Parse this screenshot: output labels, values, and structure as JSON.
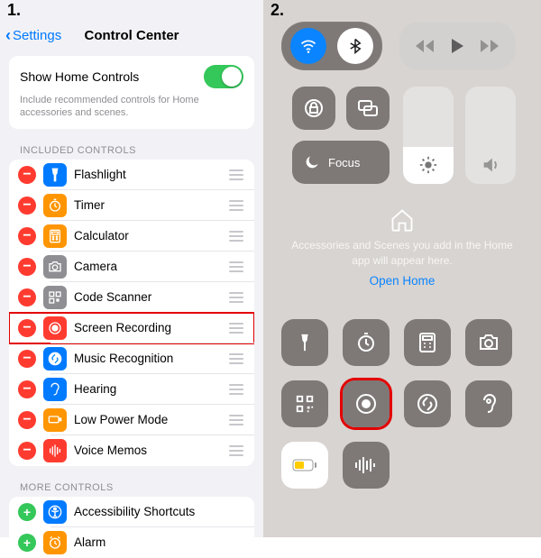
{
  "steps": {
    "one": "1.",
    "two": "2."
  },
  "left": {
    "back": "Settings",
    "title": "Control Center",
    "showHomeLabel": "Show Home Controls",
    "showHomeHint": "Include recommended controls for Home accessories and scenes.",
    "includedHeader": "INCLUDED CONTROLS",
    "moreHeader": "MORE CONTROLS",
    "included": [
      {
        "label": "Flashlight",
        "color": "blue",
        "icon": "flashlight"
      },
      {
        "label": "Timer",
        "color": "orange",
        "icon": "timer"
      },
      {
        "label": "Calculator",
        "color": "orange",
        "icon": "calculator"
      },
      {
        "label": "Camera",
        "color": "gray",
        "icon": "camera"
      },
      {
        "label": "Code Scanner",
        "color": "gray",
        "icon": "qrcode"
      },
      {
        "label": "Screen Recording",
        "color": "red",
        "icon": "record",
        "highlight": true
      },
      {
        "label": "Music Recognition",
        "color": "blue",
        "icon": "shazam"
      },
      {
        "label": "Hearing",
        "color": "blue",
        "icon": "ear"
      },
      {
        "label": "Low Power Mode",
        "color": "orange",
        "icon": "battery"
      },
      {
        "label": "Voice Memos",
        "color": "red",
        "icon": "waveform"
      }
    ],
    "more": [
      {
        "label": "Accessibility Shortcuts",
        "color": "blue",
        "icon": "accessibility"
      },
      {
        "label": "Alarm",
        "color": "orange",
        "icon": "alarm"
      }
    ]
  },
  "right": {
    "focus": "Focus",
    "homeTxt": "Accessories and Scenes you add in the Home app will appear here.",
    "openHome": "Open Home"
  }
}
